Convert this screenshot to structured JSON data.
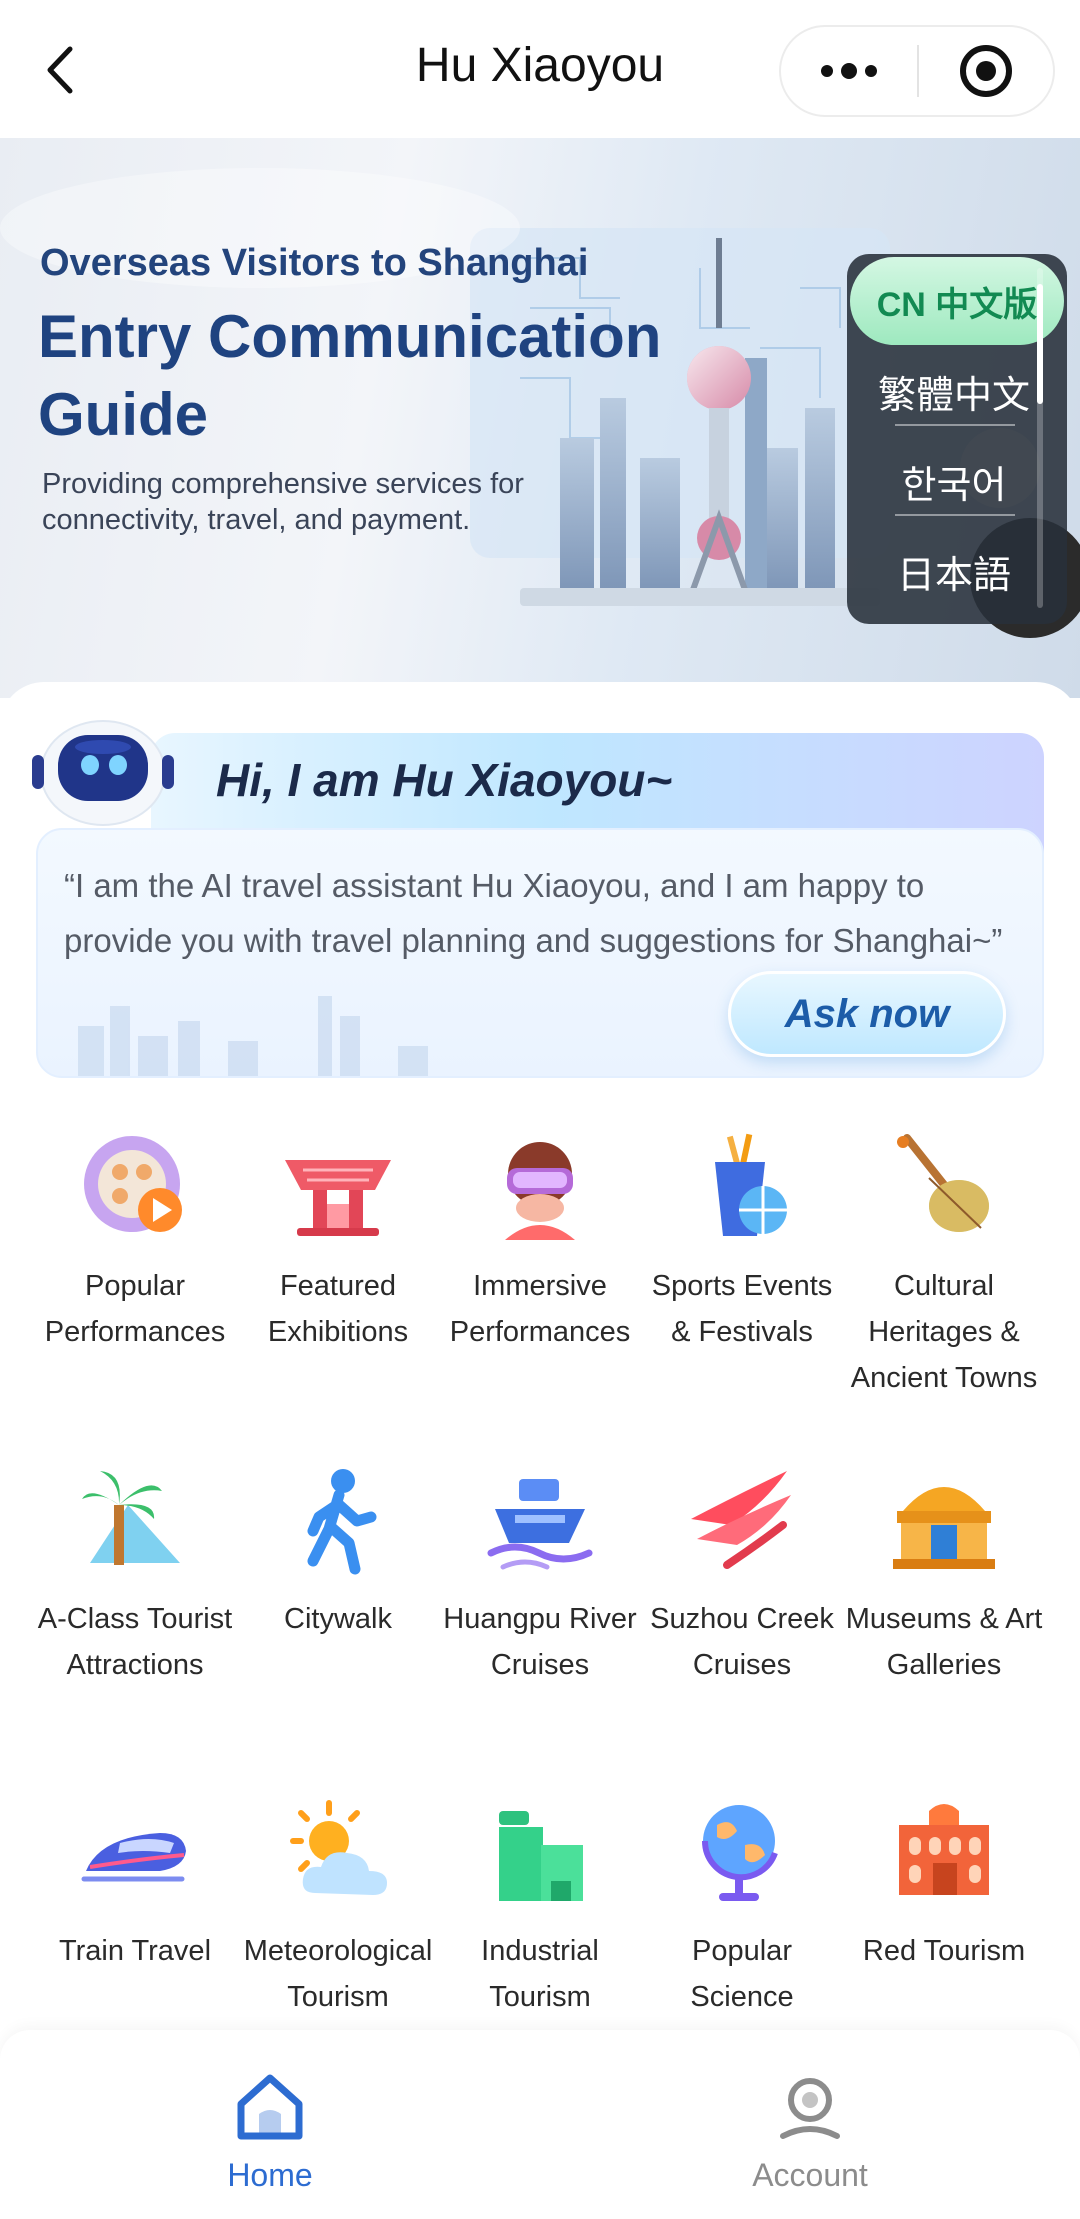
{
  "topbar": {
    "title": "Hu Xiaoyou",
    "back_icon": "chevron-left-icon",
    "more_icon": "more-dots-icon",
    "close_icon": "target-close-icon"
  },
  "hero": {
    "kicker": "Overseas Visitors to Shanghai",
    "title": "Entry Communication Guide",
    "subtitle": "Providing comprehensive services for connectivity, travel, and payment.",
    "languages": {
      "selected": "CN 中文版",
      "options": [
        "繁體中文",
        "한국어",
        "日本語"
      ]
    }
  },
  "assistant": {
    "greeting": "Hi,  I am Hu Xiaoyou~",
    "intro": "“I am the AI travel assistant Hu Xiaoyou, and I am happy to provide you with travel planning and suggestions for Shanghai~”",
    "ask_label": "Ask now"
  },
  "categories": [
    {
      "label": "Popular Performances",
      "icon": "film-reel-icon"
    },
    {
      "label": "Featured Exhibitions",
      "icon": "china-pavilion-icon"
    },
    {
      "label": "Immersive Performances",
      "icon": "vr-headset-icon"
    },
    {
      "label": "Sports Events & Festivals",
      "icon": "basketball-cup-icon"
    },
    {
      "label": "Cultural Heritages & Ancient Towns",
      "icon": "pipa-instrument-icon"
    },
    {
      "label": "A-Class Tourist Attractions",
      "icon": "palm-mountain-icon"
    },
    {
      "label": "Citywalk",
      "icon": "walking-person-icon"
    },
    {
      "label": "Huangpu River Cruises",
      "icon": "cruise-ship-icon"
    },
    {
      "label": "Suzhou Creek Cruises",
      "icon": "sailboat-icon"
    },
    {
      "label": "Museums & Art Galleries",
      "icon": "museum-icon"
    },
    {
      "label": "Train Travel",
      "icon": "bullet-train-icon"
    },
    {
      "label": "Meteorological Tourism",
      "icon": "sun-cloud-icon"
    },
    {
      "label": "Industrial Tourism",
      "icon": "factory-icon"
    },
    {
      "label": "Popular Science",
      "icon": "globe-icon"
    },
    {
      "label": "Red Tourism",
      "icon": "red-building-icon"
    }
  ],
  "bottom_nav": {
    "home_label": "Home",
    "account_label": "Account",
    "active": "Home"
  },
  "colors": {
    "brand_blue": "#1f4380",
    "nav_active": "#2d6cd1",
    "nav_inactive": "#8c8c8c",
    "lang_selected": "#128a52"
  }
}
